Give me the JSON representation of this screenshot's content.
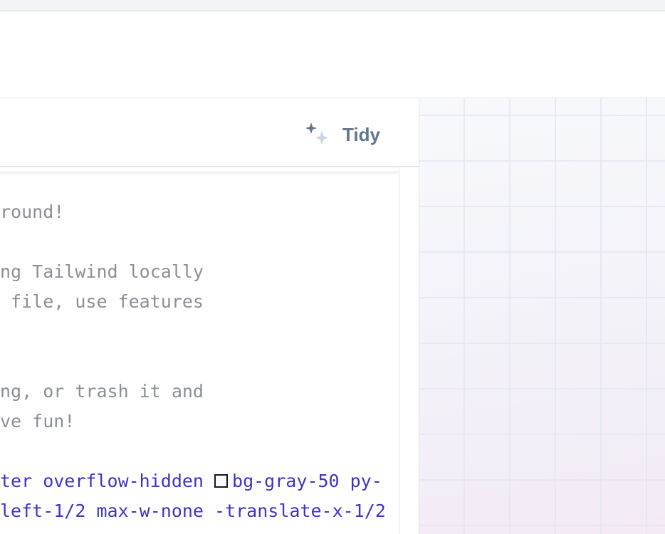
{
  "toolbar": {
    "tidy_label": "Tidy",
    "tidy_icon": "sparkles-icon"
  },
  "editor": {
    "lines": [
      "round!",
      "",
      "ng Tailwind locally",
      " file, use features",
      "",
      "",
      "ng, or trash it and",
      "ve fun!",
      ""
    ],
    "class_lines": [
      {
        "before_swatch": "ter overflow-hidden ",
        "after_swatch": "bg-gray-50 py-",
        "swatch_color": "#f9fafb"
      },
      {
        "before_swatch": "left-1/2 max-w-none -translate-x-1/2",
        "after_swatch": ""
      }
    ]
  },
  "colors": {
    "comment": "#8a8f98",
    "class_token": "#3b35c9",
    "tidy_text": "#64748b",
    "border": "#e5e7eb"
  }
}
